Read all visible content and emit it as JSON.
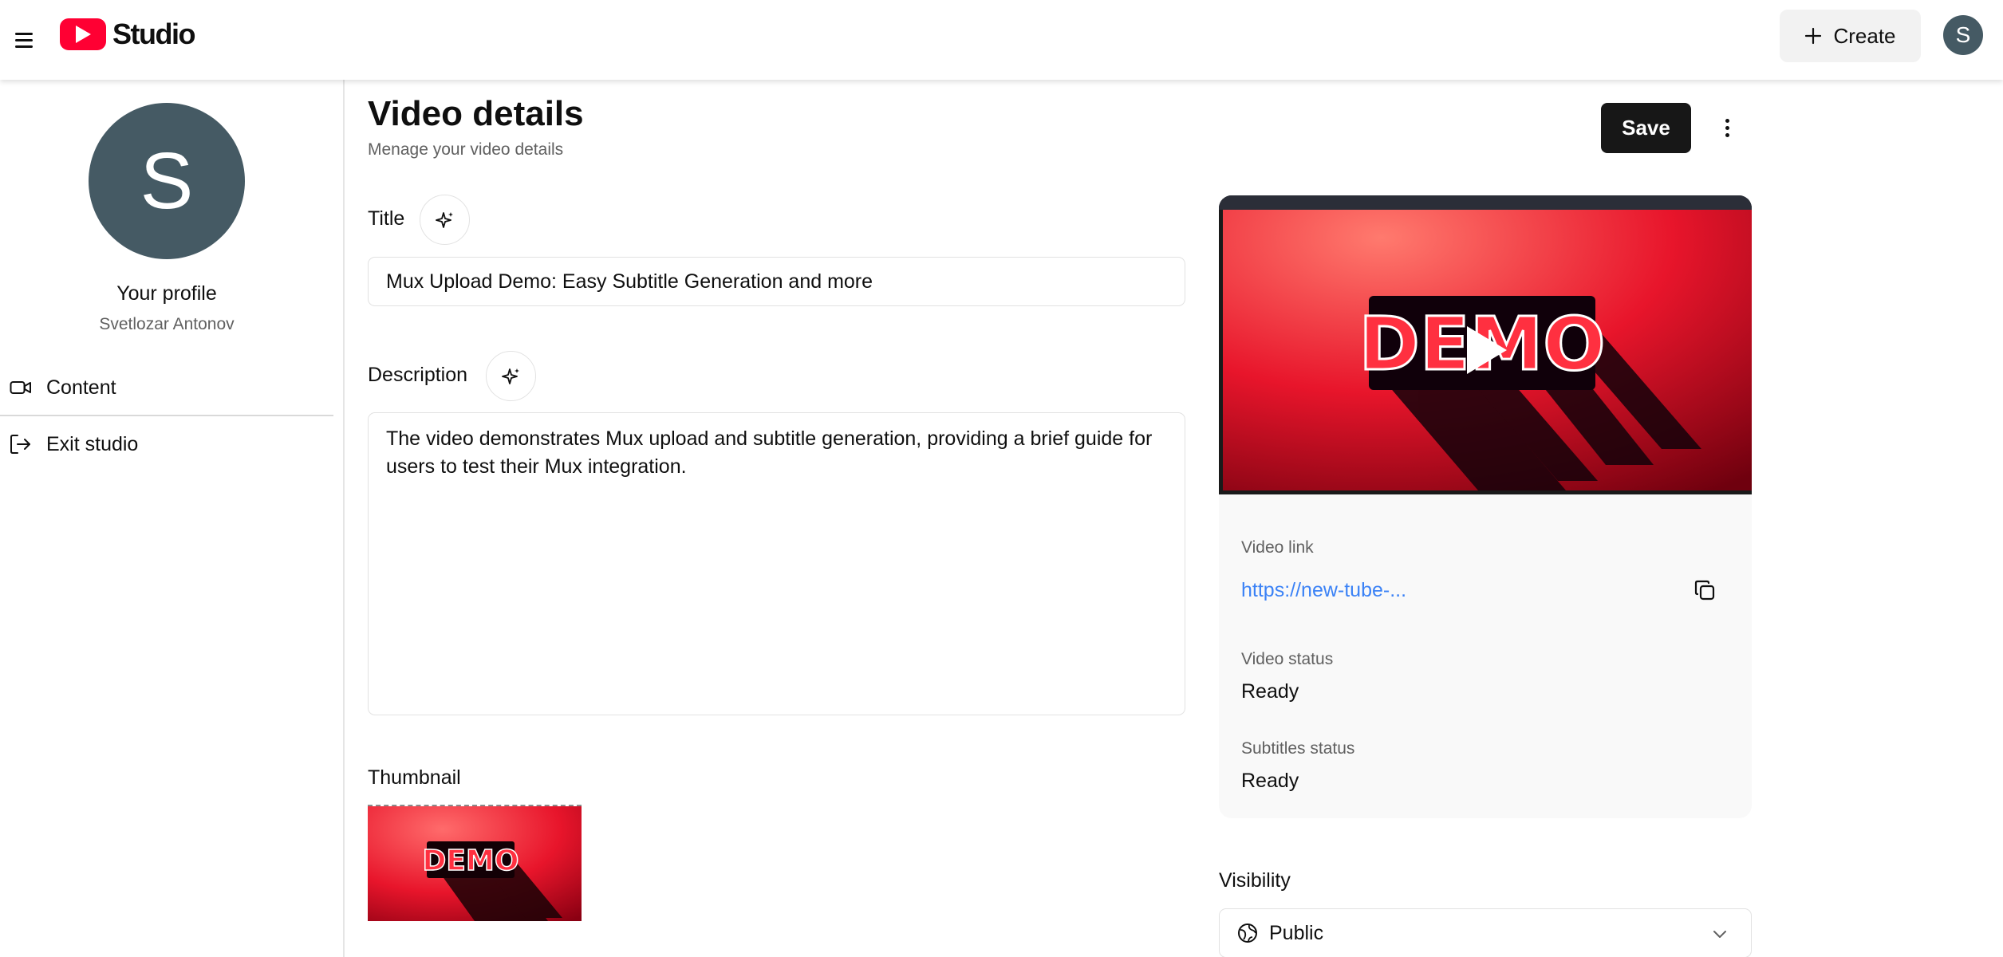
{
  "header": {
    "logo_text": "Studio",
    "create_label": "Create",
    "user_initial": "S"
  },
  "sidebar": {
    "avatar_initial": "S",
    "profile_label": "Your profile",
    "profile_name": "Svetlozar Antonov",
    "items": [
      {
        "label": "Content",
        "icon": "video-camera-icon"
      },
      {
        "label": "Exit studio",
        "icon": "log-out-icon"
      }
    ]
  },
  "page": {
    "title": "Video details",
    "subtitle": "Menage your video details",
    "save_label": "Save"
  },
  "form": {
    "title_label": "Title",
    "title_value": "Mux Upload Demo: Easy Subtitle Generation and more",
    "description_label": "Description",
    "description_value": "The video demonstrates Mux upload and subtitle generation, providing a brief guide for users to test their Mux integration.",
    "thumbnail_label": "Thumbnail",
    "thumbnail_text": "DEMO"
  },
  "video_card": {
    "preview_text": "DEMO",
    "link_label": "Video link",
    "link_value": "https://new-tube-...",
    "status_label": "Video status",
    "status_value": "Ready",
    "subtitles_label": "Subtitles status",
    "subtitles_value": "Ready"
  },
  "visibility": {
    "label": "Visibility",
    "selected": "Public"
  },
  "colors": {
    "brand_red": "#ff0033",
    "avatar": "#455a64",
    "link": "#3b82f6",
    "save_button": "#171717"
  }
}
